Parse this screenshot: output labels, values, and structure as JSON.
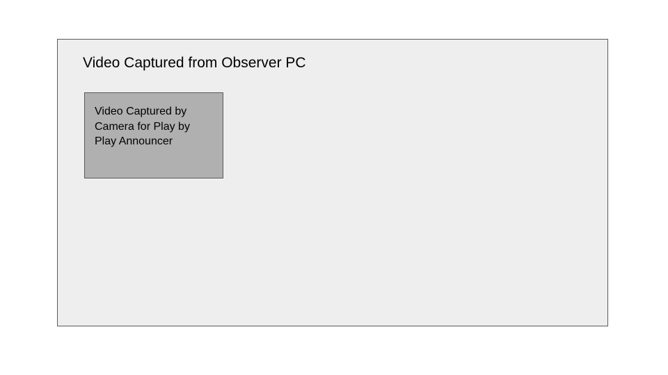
{
  "outer": {
    "title": "Video Captured from Observer PC"
  },
  "inner": {
    "text": "Video Captured by Camera for Play by Play Announcer"
  }
}
